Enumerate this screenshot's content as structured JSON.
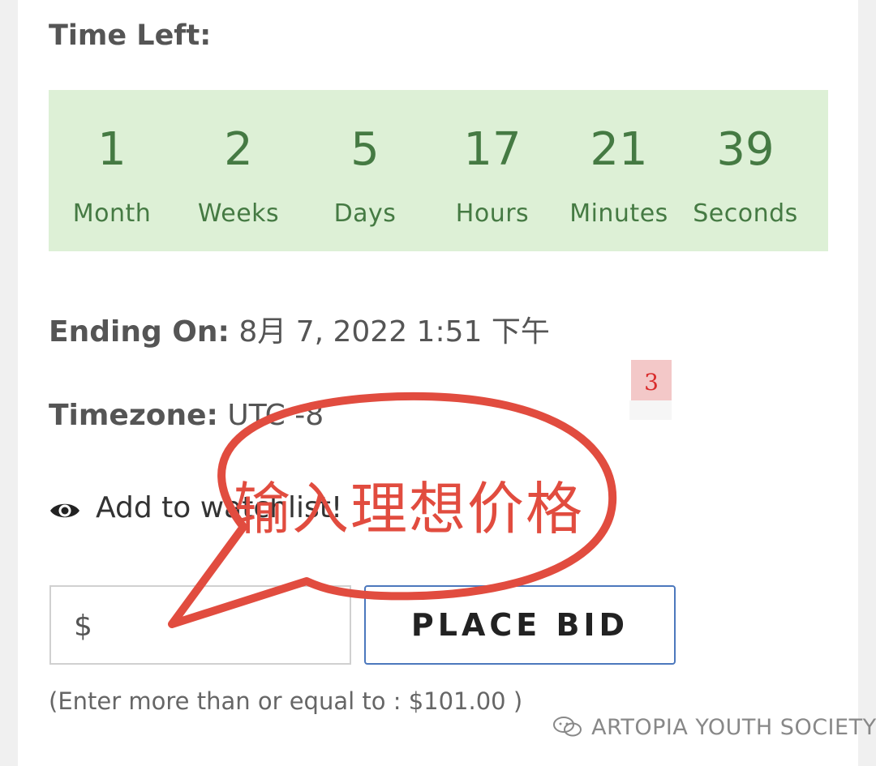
{
  "auction": {
    "time_left_label": "Time Left:",
    "countdown": [
      {
        "value": "1",
        "unit": "Month"
      },
      {
        "value": "2",
        "unit": "Weeks"
      },
      {
        "value": "5",
        "unit": "Days"
      },
      {
        "value": "17",
        "unit": "Hours"
      },
      {
        "value": "21",
        "unit": "Minutes"
      },
      {
        "value": "39",
        "unit": "Seconds"
      }
    ],
    "ending_label": "Ending On:",
    "ending_value": "8月 7, 2022 1:51 下午",
    "timezone_label": "Timezone:",
    "timezone_value": "UTC -8",
    "watchlist_label": "Add to watchlist!",
    "bid_currency": "$",
    "bid_value": "",
    "place_bid_label": "PLACE BID",
    "bid_hint": "(Enter more than or equal to : $101.00 )"
  },
  "annotation": {
    "badge": "3",
    "callout_text": "输入理想价格"
  },
  "watermark": {
    "text": "ARTOPIA YOUTH SOCIETY"
  },
  "colors": {
    "countdown_bg": "#ddf0d6",
    "countdown_text": "#457a43",
    "button_border": "#4c78bd",
    "callout_red": "#e14c3f"
  },
  "icons": {
    "watchlist": "eye-icon",
    "watermark": "wechat-icon"
  }
}
